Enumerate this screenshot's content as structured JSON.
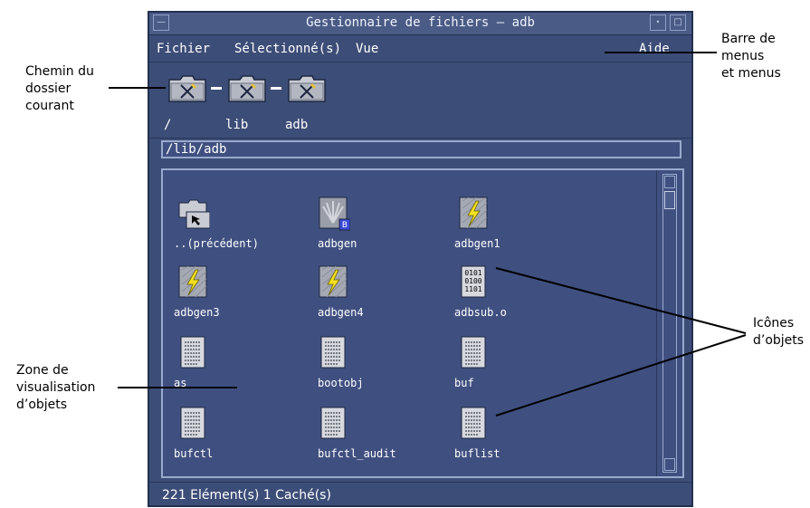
{
  "window": {
    "title": "Gestionnaire de fichiers – adb",
    "menus": [
      {
        "label": "Fichier"
      },
      {
        "label": "Sélectionné(s)"
      },
      {
        "label": "Vue"
      },
      {
        "label": "Aide"
      }
    ]
  },
  "path": {
    "segments": [
      "/",
      "lib",
      "adb"
    ],
    "field_value": "/lib/adb"
  },
  "objects": [
    {
      "label": "..(précédent)",
      "icon": "parent-folder-icon"
    },
    {
      "label": "adbgen",
      "icon": "shell-script-icon"
    },
    {
      "label": "adbgen1",
      "icon": "executable-icon"
    },
    {
      "label": "adbgen3",
      "icon": "executable-icon"
    },
    {
      "label": "adbgen4",
      "icon": "executable-icon"
    },
    {
      "label": "adbsub.o",
      "icon": "binary-file-icon"
    },
    {
      "label": "as",
      "icon": "text-file-icon"
    },
    {
      "label": "bootobj",
      "icon": "text-file-icon"
    },
    {
      "label": "buf",
      "icon": "text-file-icon"
    },
    {
      "label": "bufctl",
      "icon": "text-file-icon"
    },
    {
      "label": "bufctl_audit",
      "icon": "text-file-icon"
    },
    {
      "label": "buflist",
      "icon": "text-file-icon"
    }
  ],
  "status": {
    "text": "221 Elément(s) 1 Caché(s)"
  },
  "annotations": {
    "menubar": [
      "Barre de",
      "menus",
      "et menus"
    ],
    "path": [
      "Chemin du",
      "dossier",
      "courant"
    ],
    "view": [
      "Zone de",
      "visualisation",
      "d’objets"
    ],
    "icons": [
      "Icônes",
      "d’objets"
    ]
  },
  "colors": {
    "window_bg": "#3c4d77",
    "executable": "#f4e020"
  }
}
